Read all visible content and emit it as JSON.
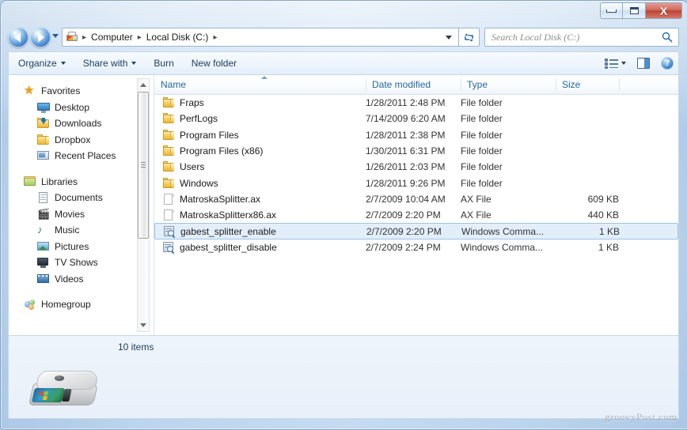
{
  "window": {
    "controls": {
      "minimize_label": "Minimize",
      "maximize_label": "Maximize",
      "close_label": "X"
    }
  },
  "addressbar": {
    "back_label": "Back",
    "forward_label": "Forward",
    "history_label": "Recent pages",
    "breadcrumbs": [
      "Computer",
      "Local Disk (C:)"
    ],
    "separator": "▸",
    "refresh_label": "↻",
    "drive_icon": "local-disk-icon"
  },
  "search": {
    "placeholder": "Search Local Disk (C:)",
    "value": ""
  },
  "toolbar": {
    "organize_label": "Organize",
    "share_label": "Share with",
    "burn_label": "Burn",
    "newfolder_label": "New folder",
    "views_label": "Change your view",
    "preview_label": "Show the preview pane",
    "help_label": "?"
  },
  "sidebar": {
    "groups": [
      {
        "name": "Favorites",
        "icon": "star-icon",
        "items": [
          {
            "label": "Desktop",
            "icon": "desktop-icon"
          },
          {
            "label": "Downloads",
            "icon": "downloads-folder-icon"
          },
          {
            "label": "Dropbox",
            "icon": "folder-icon"
          },
          {
            "label": "Recent Places",
            "icon": "recent-places-icon"
          }
        ]
      },
      {
        "name": "Libraries",
        "icon": "libraries-icon",
        "items": [
          {
            "label": "Documents",
            "icon": "document-icon"
          },
          {
            "label": "Movies",
            "icon": "movies-icon"
          },
          {
            "label": "Music",
            "icon": "music-note-icon"
          },
          {
            "label": "Pictures",
            "icon": "picture-icon"
          },
          {
            "label": "TV Shows",
            "icon": "tv-icon"
          },
          {
            "label": "Videos",
            "icon": "video-icon"
          }
        ]
      },
      {
        "name": "Homegroup",
        "icon": "homegroup-icon",
        "items": []
      }
    ]
  },
  "filelist": {
    "columns": [
      {
        "label": "Name",
        "key": "name"
      },
      {
        "label": "Date modified",
        "key": "date"
      },
      {
        "label": "Type",
        "key": "type"
      },
      {
        "label": "Size",
        "key": "size"
      }
    ],
    "sort": {
      "column": "Name",
      "direction": "ascending"
    },
    "rows": [
      {
        "name": "Fraps",
        "date": "1/28/2011 2:48 PM",
        "type": "File folder",
        "size": "",
        "icon": "folder-icon",
        "selected": false
      },
      {
        "name": "PerfLogs",
        "date": "7/14/2009 6:20 AM",
        "type": "File folder",
        "size": "",
        "icon": "folder-icon",
        "selected": false
      },
      {
        "name": "Program Files",
        "date": "1/28/2011 2:38 PM",
        "type": "File folder",
        "size": "",
        "icon": "folder-icon",
        "selected": false
      },
      {
        "name": "Program Files (x86)",
        "date": "1/30/2011 6:31 PM",
        "type": "File folder",
        "size": "",
        "icon": "folder-icon",
        "selected": false
      },
      {
        "name": "Users",
        "date": "1/26/2011 2:03 PM",
        "type": "File folder",
        "size": "",
        "icon": "folder-icon",
        "selected": false
      },
      {
        "name": "Windows",
        "date": "1/28/2011 9:26 PM",
        "type": "File folder",
        "size": "",
        "icon": "folder-icon",
        "selected": false
      },
      {
        "name": "MatroskaSplitter.ax",
        "date": "2/7/2009 10:04 AM",
        "type": "AX File",
        "size": "609 KB",
        "icon": "blank-file-icon",
        "selected": false
      },
      {
        "name": "MatroskaSplitterx86.ax",
        "date": "2/7/2009 2:20 PM",
        "type": "AX File",
        "size": "440 KB",
        "icon": "blank-file-icon",
        "selected": false
      },
      {
        "name": "gabest_splitter_enable",
        "date": "2/7/2009 2:20 PM",
        "type": "Windows Comma...",
        "size": "1 KB",
        "icon": "registry-file-icon",
        "selected": true
      },
      {
        "name": "gabest_splitter_disable",
        "date": "2/7/2009 2:24 PM",
        "type": "Windows Comma...",
        "size": "1 KB",
        "icon": "registry-file-icon",
        "selected": false
      }
    ]
  },
  "details": {
    "item_count": "10 items",
    "icon": "hard-disk-icon"
  },
  "watermark": {
    "text": "groovyPost.com"
  },
  "colors": {
    "accent": "#25679e",
    "selection_fill": "#e3eefb",
    "selection_border": "#9dc3e8",
    "folder_yellow": "#f8d169",
    "close_red": "#bc4332"
  }
}
